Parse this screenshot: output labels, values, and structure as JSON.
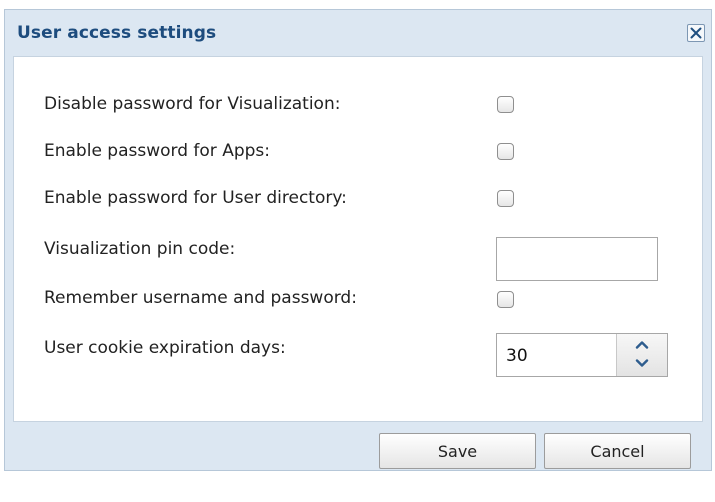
{
  "dialog": {
    "title": "User access settings",
    "close_icon": "close-icon",
    "fields": [
      {
        "label": "Disable password for Visualization:",
        "type": "checkbox",
        "checked": false
      },
      {
        "label": "Enable password for Apps:",
        "type": "checkbox",
        "checked": false
      },
      {
        "label": "Enable password for User directory:",
        "type": "checkbox",
        "checked": false
      },
      {
        "label": "Visualization pin code:",
        "type": "text",
        "value": ""
      },
      {
        "label": "Remember username and password:",
        "type": "checkbox",
        "checked": false
      },
      {
        "label": "User cookie expiration days:",
        "type": "number",
        "value": "30"
      }
    ],
    "buttons": {
      "save": "Save",
      "cancel": "Cancel"
    }
  },
  "colors": {
    "title": "#1d4c7e",
    "frame": "#dce7f2",
    "content_bg": "#ffffff"
  }
}
